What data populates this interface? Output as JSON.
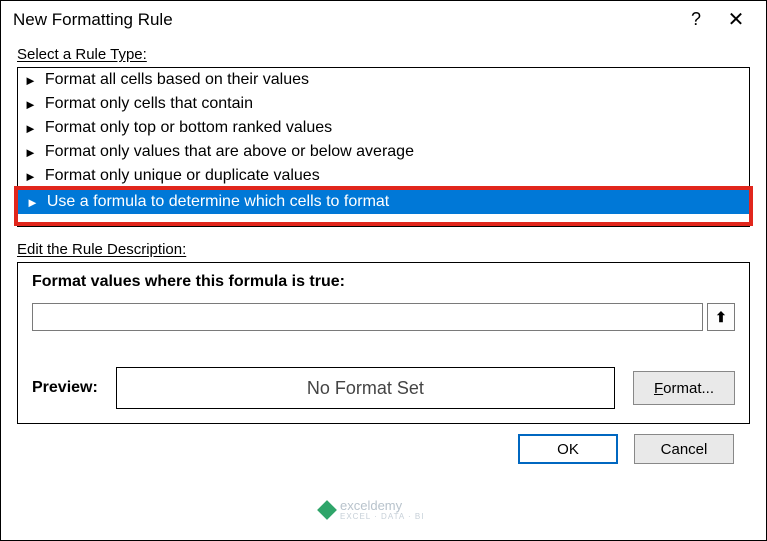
{
  "title": "New Formatting Rule",
  "section_rule_type": "Select a Rule Type:",
  "rule_items": [
    "Format all cells based on their values",
    "Format only cells that contain",
    "Format only top or bottom ranked values",
    "Format only values that are above or below average",
    "Format only unique or duplicate values",
    "Use a formula to determine which cells to format"
  ],
  "section_edit": "Edit the Rule Description:",
  "panel_label": "Format values where this formula is true:",
  "formula_value": "",
  "ref_icon": "⬆",
  "preview_label": "Preview:",
  "preview_text": "No Format Set",
  "format_btn_prefix": "F",
  "format_btn_rest": "ormat...",
  "ok_label": "OK",
  "cancel_label": "Cancel",
  "help_icon": "?",
  "close_icon": "✕",
  "watermark": {
    "name": "exceldemy",
    "sub": "EXCEL · DATA · BI"
  }
}
